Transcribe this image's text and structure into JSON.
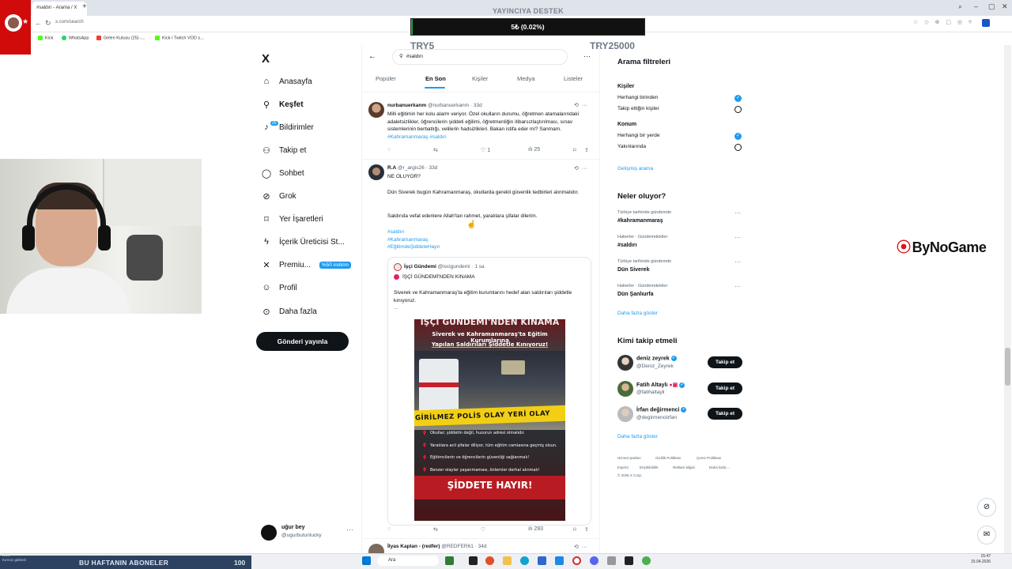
{
  "browser": {
    "tab_title": "#saldırı - Arama / X",
    "url": "x.com/search",
    "bookmarks": [
      "Kick",
      "WhatsApp",
      "Gelen Kutusu (25) -...",
      "Kick / Twitch VOD s..."
    ]
  },
  "overlay": {
    "donate_title": "YAYINCIYA DESTEK",
    "donate_amount": "5₺ (0.02%)",
    "donate_progress": 0.0002,
    "donate_min": "TRY5",
    "donate_max": "TRY25000",
    "sponsor": "ByNoGame",
    "subs_label": "BU HAFTANIN ABONELER",
    "subs_count": "100",
    "subs_left_text": "zaza\nKırmızı gülmeli"
  },
  "sidebar": {
    "logo": "X",
    "items": [
      {
        "label": "Anasayfa",
        "icon": "home-icon"
      },
      {
        "label": "Keşfet",
        "icon": "search-icon"
      },
      {
        "label": "Bildirimler",
        "icon": "bell-icon",
        "badge": "20"
      },
      {
        "label": "Takip et",
        "icon": "add-person-icon"
      },
      {
        "label": "Sohbet",
        "icon": "chat-icon"
      },
      {
        "label": "Grok",
        "icon": "grok-icon"
      },
      {
        "label": "Yer İşaretleri",
        "icon": "bookmark-icon"
      },
      {
        "label": "İçerik Üreticisi St...",
        "icon": "lightning-icon"
      },
      {
        "label": "Premiu...",
        "icon": "x-premium-icon",
        "badge": "%50 indirim"
      },
      {
        "label": "Profil",
        "icon": "person-icon"
      },
      {
        "label": "Daha fazla",
        "icon": "more-circle-icon"
      }
    ],
    "post_button": "Gönderi yayınla",
    "account": {
      "name": "uğur bey",
      "handle": "@ugurbutunlucky"
    }
  },
  "search": {
    "query": "#saldırı",
    "tabs": [
      "Popüler",
      "En Son",
      "Kişiler",
      "Medya",
      "Listeler"
    ],
    "active_tab": "En Son"
  },
  "tweets": [
    {
      "name": "nurbanuerkanm",
      "handle": "@nurbanuerkanm · 33d",
      "text": "Milli eğitimin her kolu alarm veriyor. Özel okulların durumu, öğretmen atamalarındaki adaletsizlikler, öğrencilerin şiddeti eğilimi, öğretmenliğin itibarsızlaştırılması, sınav sistemlerinin berbatlığı, velilerin hadsizlikleri. Bakan istifa eder mi? Sanmam.",
      "tags": "#Kahramanmaraş #saldırı",
      "likes": "1",
      "views": "25"
    },
    {
      "name": "R.A",
      "handle": "@r_argis26 · 33d",
      "lines": [
        "NE OLUYOR?",
        "Dün Siverek bugün Kahramanmaraş, okullarda gerekli güvenlik tedbirleri alınmalıdır.",
        "Saldırıda vefat edenlere Allah'tan rahmet, yaralılara şifalar dilerim."
      ],
      "tags": [
        "#saldırı",
        "#Kahramanmaraş",
        "#EğitimdeŞiddeteHayır"
      ],
      "views": "293",
      "quote": {
        "name": "İşçi Gündemi",
        "handle": "@iscigundemi · 1 sa",
        "sub": "İŞÇİ GÜNDEMİ'NDEN KINAMA",
        "text": "Siverek ve Kahramanmaraş'ta eğitim kurumlarını hedef alan saldırıları şiddetle kınıyoruz.",
        "ellipsis": "...",
        "poster": {
          "title": "İŞÇİ GÜNDEMİ'NDEN KINAMA",
          "sub1": "Siverek ve Kahramanmaraş'ta Eğitim Kurumlarına",
          "sub2": "Yapılan Saldırıları Şiddetle Kınıyoruz!",
          "tape": "GİRİLMEZ   POLİS OLAY YERİ   OLAY",
          "bullets": [
            "Okullar; şiddetin değil, huzurun adresi olmalıdır.",
            "Yaralılara acil şifalar diliyor, tüm eğitim camiasına geçmiş olsun.",
            "Eğitimcilerin ve öğrencilerin güvenliği sağlanmalı!",
            "Benzer olaylar yaşanmaması, önlemler derhal alınmalı!"
          ],
          "footer": "ŞİDDETE HAYIR!"
        }
      }
    },
    {
      "name": "İlyas Kaplan - (redfer)",
      "handle": "@REDFER61 · 34d"
    }
  ],
  "right": {
    "filters_title": "Arama filtreleri",
    "people_label": "Kişiler",
    "people_opts": [
      "Herhangi birinden",
      "Takip ettiğin kişiler"
    ],
    "location_label": "Konum",
    "location_opts": [
      "Herhangi bir yerde",
      "Yakınlarında"
    ],
    "advanced": "Gelişmiş arama",
    "trends_title": "Neler oluyor?",
    "trends": [
      {
        "meta": "Türkiye tarihinde gündemde",
        "title": "#kahramanmaraş"
      },
      {
        "meta": "Haberler · Gündemdekiler",
        "title": "#saldırı"
      },
      {
        "meta": "Türkiye tarihinde gündemde",
        "title": "Dün Siverek"
      },
      {
        "meta": "Haberler · Gündemdekiler",
        "title": "Dün Şanlıurfa"
      }
    ],
    "show_more": "Daha fazla göster",
    "wtf_title": "Kimi takip etmeli",
    "wtf": [
      {
        "name": "deniz zeyrek",
        "handle": "@Deniz_Zeyrek",
        "button": "Takip et"
      },
      {
        "name": "Fatih Altaylı",
        "handle": "@fatihaltayli",
        "button": "Takip et"
      },
      {
        "name": "İrfan değirmenci",
        "handle": "@degirmenciirfan",
        "button": "Takip et"
      }
    ],
    "footer": [
      "Hizmet Şartları",
      "Gizlilik Politikası",
      "Çerez Politikası",
      "Imprint",
      "Erişilebilirlik",
      "Reklam bilgisi",
      "Daha fazla ...",
      "© 2026 X Corp."
    ]
  },
  "taskbar": {
    "search": "Ara",
    "time": "15:47",
    "date": "15.04.2026"
  },
  "colors": {
    "accent": "#1d9bf0",
    "donate_fill": "#1ea34a",
    "subs_bg": "#2d4260"
  }
}
